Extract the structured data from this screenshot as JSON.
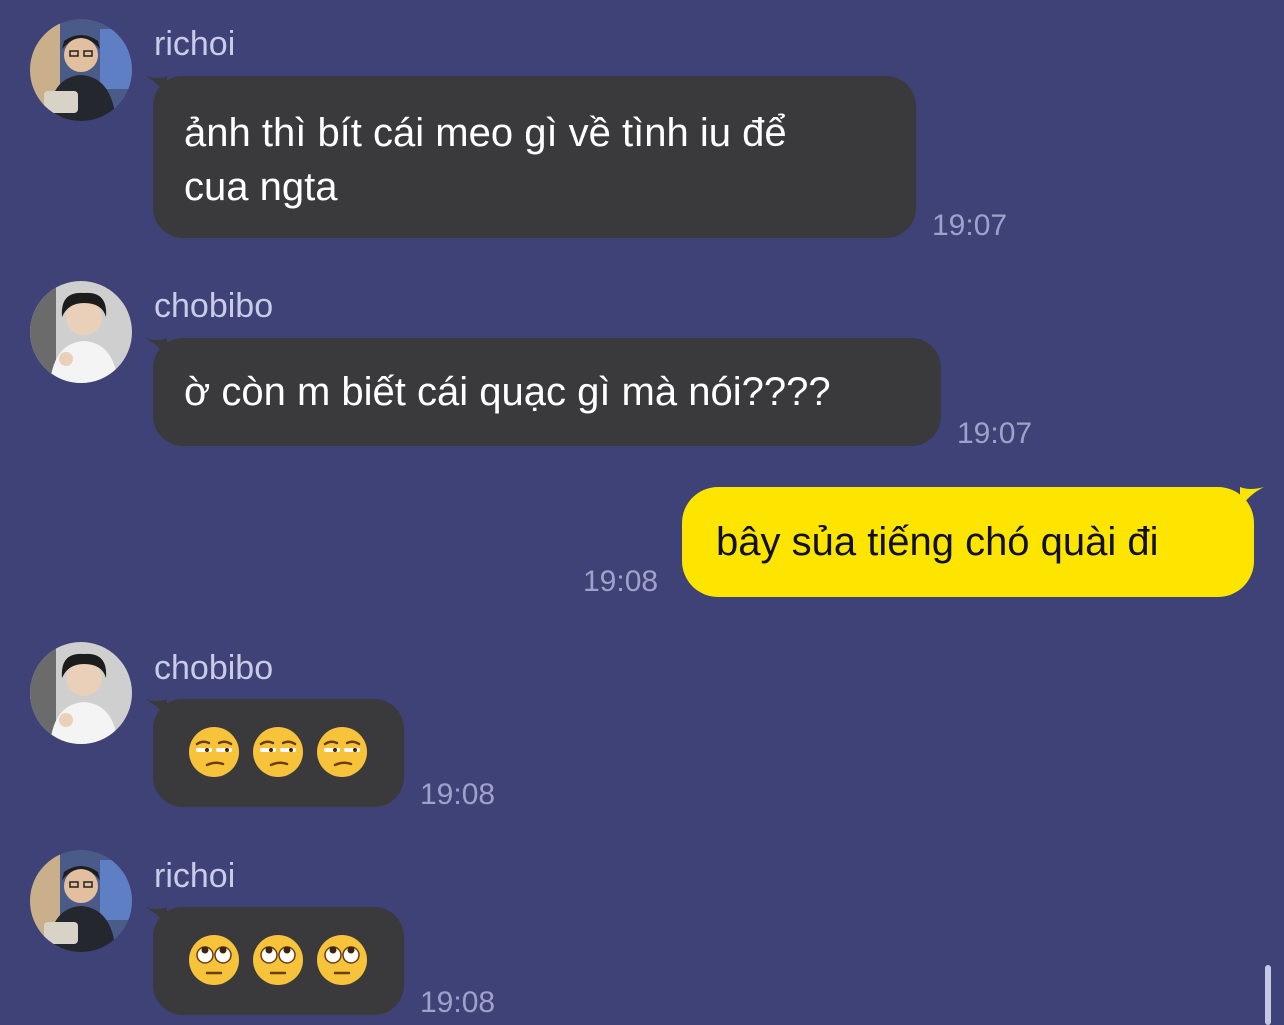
{
  "messages": [
    {
      "sender": "richoi",
      "text": "ảnh thì bít cái meo gì về tình iu để\ncua ngta",
      "time": "19:07",
      "avatar": "richoi-avatar"
    },
    {
      "sender": "chobibo",
      "text": "ờ còn m biết cái quạc gì mà nói????",
      "time": "19:07",
      "avatar": "chobibo-avatar"
    },
    {
      "sender": "me",
      "text": "bây sủa tiếng chó quài đi",
      "time": "19:08"
    },
    {
      "sender": "chobibo",
      "emoji": [
        "😒",
        "😒",
        "😒"
      ],
      "emoji_name": "unamused-face-icon",
      "time": "19:08",
      "avatar": "chobibo-avatar"
    },
    {
      "sender": "richoi",
      "emoji": [
        "🙄",
        "🙄",
        "🙄"
      ],
      "emoji_name": "rolling-eyes-face-icon",
      "time": "19:08",
      "avatar": "richoi-avatar"
    }
  ],
  "colors": {
    "background": "#3f4276",
    "incoming_bubble": "#3a3a3c",
    "outgoing_bubble": "#fee500",
    "timestamp": "#9fa2c8",
    "sender_name": "#c9cbe8"
  }
}
